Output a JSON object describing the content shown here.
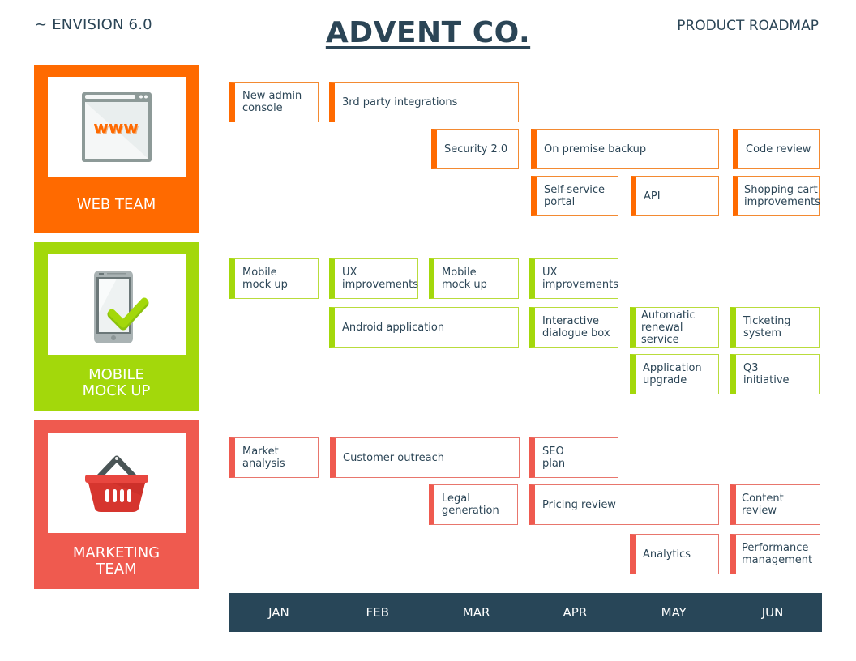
{
  "header": {
    "left": "~ ENVISION 6.0",
    "title": "ADVENT CO.",
    "right": "PRODUCT ROADMAP"
  },
  "colors": {
    "web": "#ff6a00",
    "mobile": "#a3d80b",
    "marketing": "#ef5a4f",
    "navy": "#284658"
  },
  "teams": [
    {
      "name": "WEB TEAM",
      "icon": "browser-www-icon",
      "tasks": [
        "New admin\nconsole",
        "3rd party integrations",
        "Security 2.0",
        "On premise backup",
        "Code review",
        "Self-service\nportal",
        "API",
        "Shopping cart\nimprovements"
      ]
    },
    {
      "name": "MOBILE\nMOCK UP",
      "icon": "smartphone-check-icon",
      "tasks": [
        "Mobile\nmock up",
        "UX\nimprovements",
        "Mobile\nmock up",
        "UX\nimprovements",
        "Android application",
        "Interactive\ndialogue box",
        "Automatic\nrenewal service",
        "Ticketing\nsystem",
        "Application\nupgrade",
        "Q3\ninitiative"
      ]
    },
    {
      "name": "MARKETING\nTEAM",
      "icon": "shopping-basket-icon",
      "tasks": [
        "Market\nanalysis",
        "Customer outreach",
        "SEO\nplan",
        "Legal\ngeneration",
        "Pricing review",
        "Content review",
        "Analytics",
        "Performance\nmanagement"
      ]
    }
  ],
  "timeline": {
    "months": [
      "JAN",
      "FEB",
      "MAR",
      "APR",
      "MAY",
      "JUN"
    ]
  }
}
